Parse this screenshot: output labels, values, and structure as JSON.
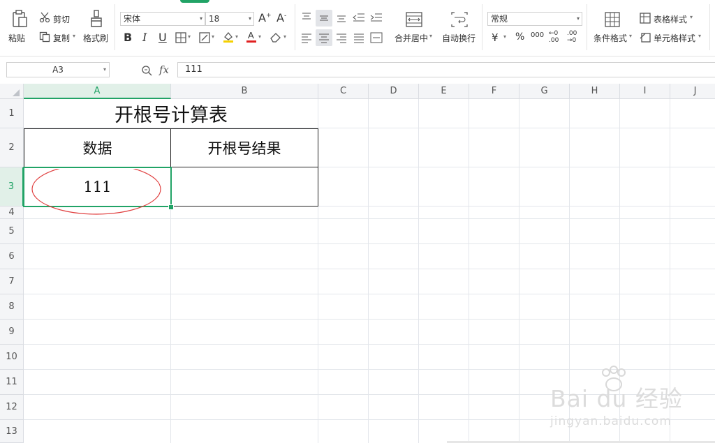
{
  "ribbon": {
    "paste": "粘贴",
    "cut": "剪切",
    "copy": "复制",
    "format_painter": "格式刷",
    "font_name": "宋体",
    "font_size": "18",
    "bold": "B",
    "italic": "I",
    "underline": "U",
    "merge_center": "合并居中",
    "wrap_text": "自动换行",
    "number_format": "常规",
    "currency": "¥",
    "percent": "%",
    "thousands": "000",
    "inc_decimal": "←0 .00",
    "dec_decimal": ".00 →0",
    "conditional_format": "条件格式",
    "table_style": "表格样式",
    "cell_style": "单元格样式"
  },
  "formula_bar": {
    "name_box": "A3",
    "fx": "fx",
    "content": "111"
  },
  "columns": [
    "A",
    "B",
    "C",
    "D",
    "E",
    "F",
    "G",
    "H",
    "I",
    "J"
  ],
  "rows": [
    "1",
    "2",
    "3",
    "4",
    "5",
    "6",
    "7",
    "8",
    "9",
    "10",
    "11",
    "12",
    "13"
  ],
  "cells": {
    "A1": "开根号计算表",
    "A2": "数据",
    "B2": "开根号结果",
    "A3": "111"
  },
  "watermark": {
    "brand": "Bai du 经验",
    "url": "jingyan.baidu.com"
  },
  "colors": {
    "selection": "#21a366",
    "annotation_ellipse": "#e04040",
    "header_bg": "#f4f5f7"
  }
}
